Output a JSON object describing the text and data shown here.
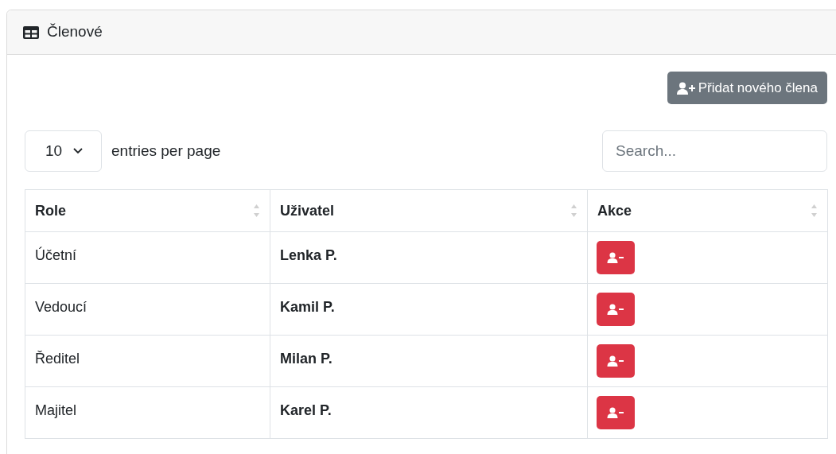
{
  "card": {
    "title": "Členové"
  },
  "add_button": {
    "label": "Přidat nového člena"
  },
  "page_size": {
    "value": "10",
    "label": "entries per page"
  },
  "search": {
    "placeholder": "Search..."
  },
  "table": {
    "columns": [
      "Role",
      "Uživatel",
      "Akce"
    ],
    "rows": [
      {
        "role": "Účetní",
        "user": "Lenka P."
      },
      {
        "role": "Vedoucí",
        "user": "Kamil P."
      },
      {
        "role": "Ředitel",
        "user": "Milan P."
      },
      {
        "role": "Majitel",
        "user": "Karel P."
      }
    ]
  }
}
